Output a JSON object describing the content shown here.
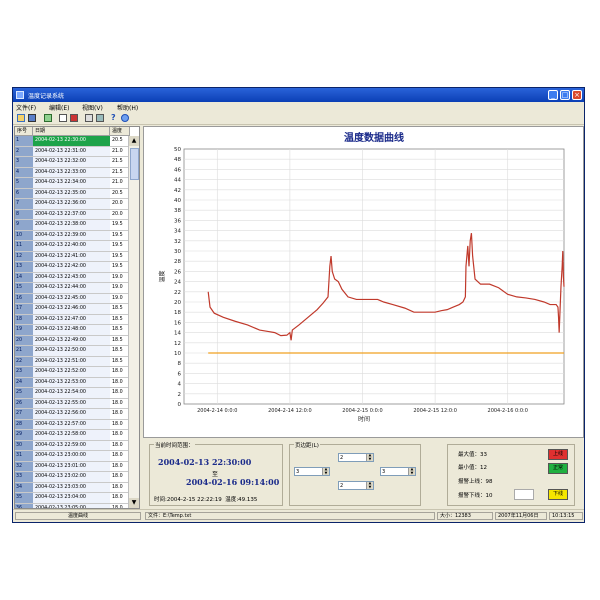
{
  "window": {
    "title": "温度记录系统"
  },
  "menu": [
    {
      "label": "文件(F)"
    },
    {
      "label": "编辑(E)"
    },
    {
      "label": "视图(V)"
    },
    {
      "label": "帮助(H)"
    }
  ],
  "toolbar_icons": [
    "open-icon",
    "save-icon",
    "download-icon",
    "chart-icon",
    "export-icon",
    "print-icon",
    "settings-icon",
    "help-icon",
    "info-icon"
  ],
  "table": {
    "headers": [
      "序号",
      "日期",
      "温度"
    ],
    "rows": [
      {
        "no": "1",
        "date": "2004-02-13 22:30:00",
        "temp": "20.5"
      },
      {
        "no": "2",
        "date": "2004-02-13 22:31:00",
        "temp": "21.0"
      },
      {
        "no": "3",
        "date": "2004-02-13 22:32:00",
        "temp": "21.5"
      },
      {
        "no": "4",
        "date": "2004-02-13 22:33:00",
        "temp": "21.5"
      },
      {
        "no": "5",
        "date": "2004-02-13 22:34:00",
        "temp": "21.0"
      },
      {
        "no": "6",
        "date": "2004-02-13 22:35:00",
        "temp": "20.5"
      },
      {
        "no": "7",
        "date": "2004-02-13 22:36:00",
        "temp": "20.0"
      },
      {
        "no": "8",
        "date": "2004-02-13 22:37:00",
        "temp": "20.0"
      },
      {
        "no": "9",
        "date": "2004-02-13 22:38:00",
        "temp": "19.5"
      },
      {
        "no": "10",
        "date": "2004-02-13 22:39:00",
        "temp": "19.5"
      },
      {
        "no": "11",
        "date": "2004-02-13 22:40:00",
        "temp": "19.5"
      },
      {
        "no": "12",
        "date": "2004-02-13 22:41:00",
        "temp": "19.5"
      },
      {
        "no": "13",
        "date": "2004-02-13 22:42:00",
        "temp": "19.5"
      },
      {
        "no": "14",
        "date": "2004-02-13 22:43:00",
        "temp": "19.0"
      },
      {
        "no": "15",
        "date": "2004-02-13 22:44:00",
        "temp": "19.0"
      },
      {
        "no": "16",
        "date": "2004-02-13 22:45:00",
        "temp": "19.0"
      },
      {
        "no": "17",
        "date": "2004-02-13 22:46:00",
        "temp": "18.5"
      },
      {
        "no": "18",
        "date": "2004-02-13 22:47:00",
        "temp": "18.5"
      },
      {
        "no": "19",
        "date": "2004-02-13 22:48:00",
        "temp": "18.5"
      },
      {
        "no": "20",
        "date": "2004-02-13 22:49:00",
        "temp": "18.5"
      },
      {
        "no": "21",
        "date": "2004-02-13 22:50:00",
        "temp": "18.5"
      },
      {
        "no": "22",
        "date": "2004-02-13 22:51:00",
        "temp": "18.5"
      },
      {
        "no": "23",
        "date": "2004-02-13 22:52:00",
        "temp": "18.0"
      },
      {
        "no": "24",
        "date": "2004-02-13 22:53:00",
        "temp": "18.0"
      },
      {
        "no": "25",
        "date": "2004-02-13 22:54:00",
        "temp": "18.0"
      },
      {
        "no": "26",
        "date": "2004-02-13 22:55:00",
        "temp": "18.0"
      },
      {
        "no": "27",
        "date": "2004-02-13 22:56:00",
        "temp": "18.0"
      },
      {
        "no": "28",
        "date": "2004-02-13 22:57:00",
        "temp": "18.0"
      },
      {
        "no": "29",
        "date": "2004-02-13 22:58:00",
        "temp": "18.0"
      },
      {
        "no": "30",
        "date": "2004-02-13 22:59:00",
        "temp": "18.0"
      },
      {
        "no": "31",
        "date": "2004-02-13 23:00:00",
        "temp": "18.0"
      },
      {
        "no": "32",
        "date": "2004-02-13 23:01:00",
        "temp": "18.0"
      },
      {
        "no": "33",
        "date": "2004-02-13 23:02:00",
        "temp": "18.0"
      },
      {
        "no": "34",
        "date": "2004-02-13 23:03:00",
        "temp": "18.0"
      },
      {
        "no": "35",
        "date": "2004-02-13 23:04:00",
        "temp": "18.0"
      },
      {
        "no": "36",
        "date": "2004-02-13 23:05:00",
        "temp": "18.0"
      }
    ]
  },
  "sidebar_footer": "温度曲线",
  "chart_data": {
    "type": "line",
    "title": "温度数据曲线",
    "xlabel": "时间",
    "ylabel": "温度",
    "ylim": [
      0,
      50
    ],
    "yticks": [
      0,
      2,
      4,
      6,
      8,
      10,
      12,
      14,
      16,
      18,
      20,
      22,
      24,
      26,
      28,
      30,
      32,
      34,
      36,
      38,
      40,
      42,
      44,
      46,
      48,
      50
    ],
    "xticks": [
      {
        "t": 24,
        "label": "2004-2-14 0:0:0"
      },
      {
        "t": 36,
        "label": "2004-2-14 12:0:0"
      },
      {
        "t": 48,
        "label": "2004-2-15 0:0:0"
      },
      {
        "t": 60,
        "label": "2004-2-15 12:0:0"
      },
      {
        "t": 72,
        "label": "2004-2-16 0:0:0"
      }
    ],
    "xrange_hours_from_2004_02_13_00_00": [
      18.5,
      81.3
    ],
    "grid": true,
    "series": [
      {
        "color": "#c0392b",
        "points": [
          [
            22.5,
            22
          ],
          [
            22.8,
            19
          ],
          [
            23.5,
            17.8
          ],
          [
            25,
            17
          ],
          [
            27,
            16.2
          ],
          [
            29,
            15.5
          ],
          [
            31,
            14.5
          ],
          [
            32.5,
            14.2
          ],
          [
            33.5,
            14
          ],
          [
            34.5,
            13.4
          ],
          [
            35.5,
            13.5
          ],
          [
            36,
            14
          ],
          [
            36.2,
            12.5
          ],
          [
            36.4,
            14.5
          ],
          [
            37.5,
            15.5
          ],
          [
            39,
            17
          ],
          [
            40.5,
            18.5
          ],
          [
            41.5,
            19.8
          ],
          [
            42.3,
            21
          ],
          [
            42.6,
            27
          ],
          [
            42.8,
            29
          ],
          [
            43,
            26
          ],
          [
            43.4,
            24.5
          ],
          [
            44,
            24
          ],
          [
            44.6,
            22.5
          ],
          [
            45.6,
            21
          ],
          [
            47,
            20.5
          ],
          [
            48.5,
            20.5
          ],
          [
            50.5,
            20.5
          ],
          [
            51.5,
            20
          ],
          [
            53,
            19.5
          ],
          [
            55,
            18.8
          ],
          [
            56.5,
            18
          ],
          [
            58,
            18
          ],
          [
            60,
            18
          ],
          [
            61,
            18.3
          ],
          [
            62,
            18.5
          ],
          [
            63,
            19
          ],
          [
            64,
            19.5
          ],
          [
            64.6,
            20
          ],
          [
            65,
            21
          ],
          [
            65.1,
            27
          ],
          [
            65.4,
            31
          ],
          [
            65.6,
            27
          ],
          [
            65.8,
            32
          ],
          [
            66,
            33.5
          ],
          [
            66.2,
            29
          ],
          [
            66.6,
            24.5
          ],
          [
            67.5,
            23.5
          ],
          [
            69,
            23.5
          ],
          [
            70.5,
            22.8
          ],
          [
            72,
            21.5
          ],
          [
            73.5,
            21
          ],
          [
            75,
            20.8
          ],
          [
            76.5,
            20.5
          ],
          [
            78,
            20
          ],
          [
            79,
            19.5
          ],
          [
            80,
            19.5
          ],
          [
            80.3,
            19
          ],
          [
            80.4,
            17
          ],
          [
            80.5,
            14
          ],
          [
            80.6,
            17
          ],
          [
            80.8,
            23
          ],
          [
            81,
            27
          ],
          [
            81.1,
            30
          ],
          [
            81.2,
            25
          ],
          [
            81.3,
            23
          ]
        ]
      },
      {
        "color": "#f0a020",
        "points": [
          [
            22.5,
            10
          ],
          [
            81.3,
            10
          ]
        ]
      }
    ]
  },
  "range": {
    "label": "当前时间范围：",
    "start": "2004-02-13 22:30:00",
    "to": "至",
    "end": "2004-02-16 09:14:00",
    "time_prefix": "时间",
    "time_value": "2004-2-15 22:22:19",
    "temp_prefix": "温度",
    "temp_value": "49.135"
  },
  "pagination": {
    "label": "页边距(L)",
    "top": "2",
    "left": "3",
    "right": "3",
    "bottom": "2"
  },
  "stats": {
    "max_label": "最大值：33",
    "min_label": "最小值：12",
    "upper_label": "报警上线：98",
    "lower_label": "报警下线：10",
    "upper_btn": "上线",
    "ok_btn": "正常",
    "lower_btn": "下线",
    "colors": {
      "upper": "#e03030",
      "ok": "#20b040",
      "lower": "#f5e600"
    }
  },
  "status": {
    "file": "文件：E:\\Temp.txt",
    "size": "大小：12383",
    "date": "2007年11月06日",
    "time": "10:13:15"
  }
}
